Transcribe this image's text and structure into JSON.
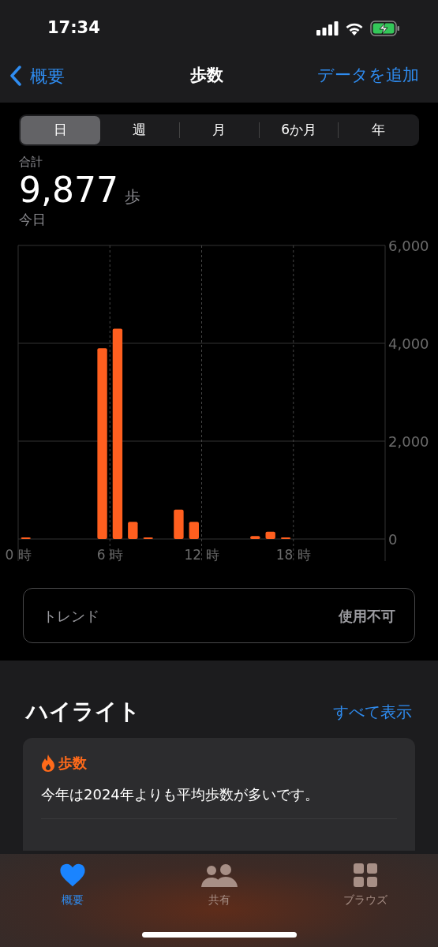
{
  "status_bar": {
    "time": "17:34"
  },
  "nav": {
    "back": "概要",
    "title": "歩数",
    "action": "データを追加"
  },
  "segments": [
    {
      "label": "日",
      "selected": true
    },
    {
      "label": "週",
      "selected": false
    },
    {
      "label": "月",
      "selected": false
    },
    {
      "label": "6か月",
      "selected": false
    },
    {
      "label": "年",
      "selected": false
    }
  ],
  "summary": {
    "label": "合計",
    "value": "9,877",
    "unit": "歩",
    "period": "今日"
  },
  "chart_data": {
    "type": "bar",
    "x": [
      0.5,
      5.5,
      6.5,
      7.5,
      8.5,
      10.5,
      11.5,
      15.5,
      16.5,
      17.5
    ],
    "values": [
      10,
      3900,
      4300,
      350,
      30,
      600,
      350,
      60,
      150,
      30
    ],
    "grid": true,
    "xlim": [
      0,
      24
    ],
    "ylim": [
      0,
      6000
    ],
    "xticks": [
      {
        "value": 0,
        "label": "0 時"
      },
      {
        "value": 6,
        "label": "6 時"
      },
      {
        "value": 12,
        "label": "12 時"
      },
      {
        "value": 18,
        "label": "18 時"
      }
    ],
    "yticks": [
      0,
      {
        "value": 2000,
        "label": "2,000"
      },
      {
        "value": 4000,
        "label": "4,000"
      },
      {
        "value": 6000,
        "label": "6,000"
      }
    ]
  },
  "trend": {
    "label": "トレンド",
    "value": "使用不可"
  },
  "highlights": {
    "title": "ハイライト",
    "link": "すべて表示",
    "card": {
      "category": "歩数",
      "text": "今年は2024年よりも平均歩数が多いです。"
    }
  },
  "tab_bar": [
    {
      "label": "概要",
      "kind": "heart",
      "selected": true
    },
    {
      "label": "共有",
      "kind": "people",
      "selected": false
    },
    {
      "label": "ブラウズ",
      "kind": "grid",
      "selected": false
    }
  ]
}
